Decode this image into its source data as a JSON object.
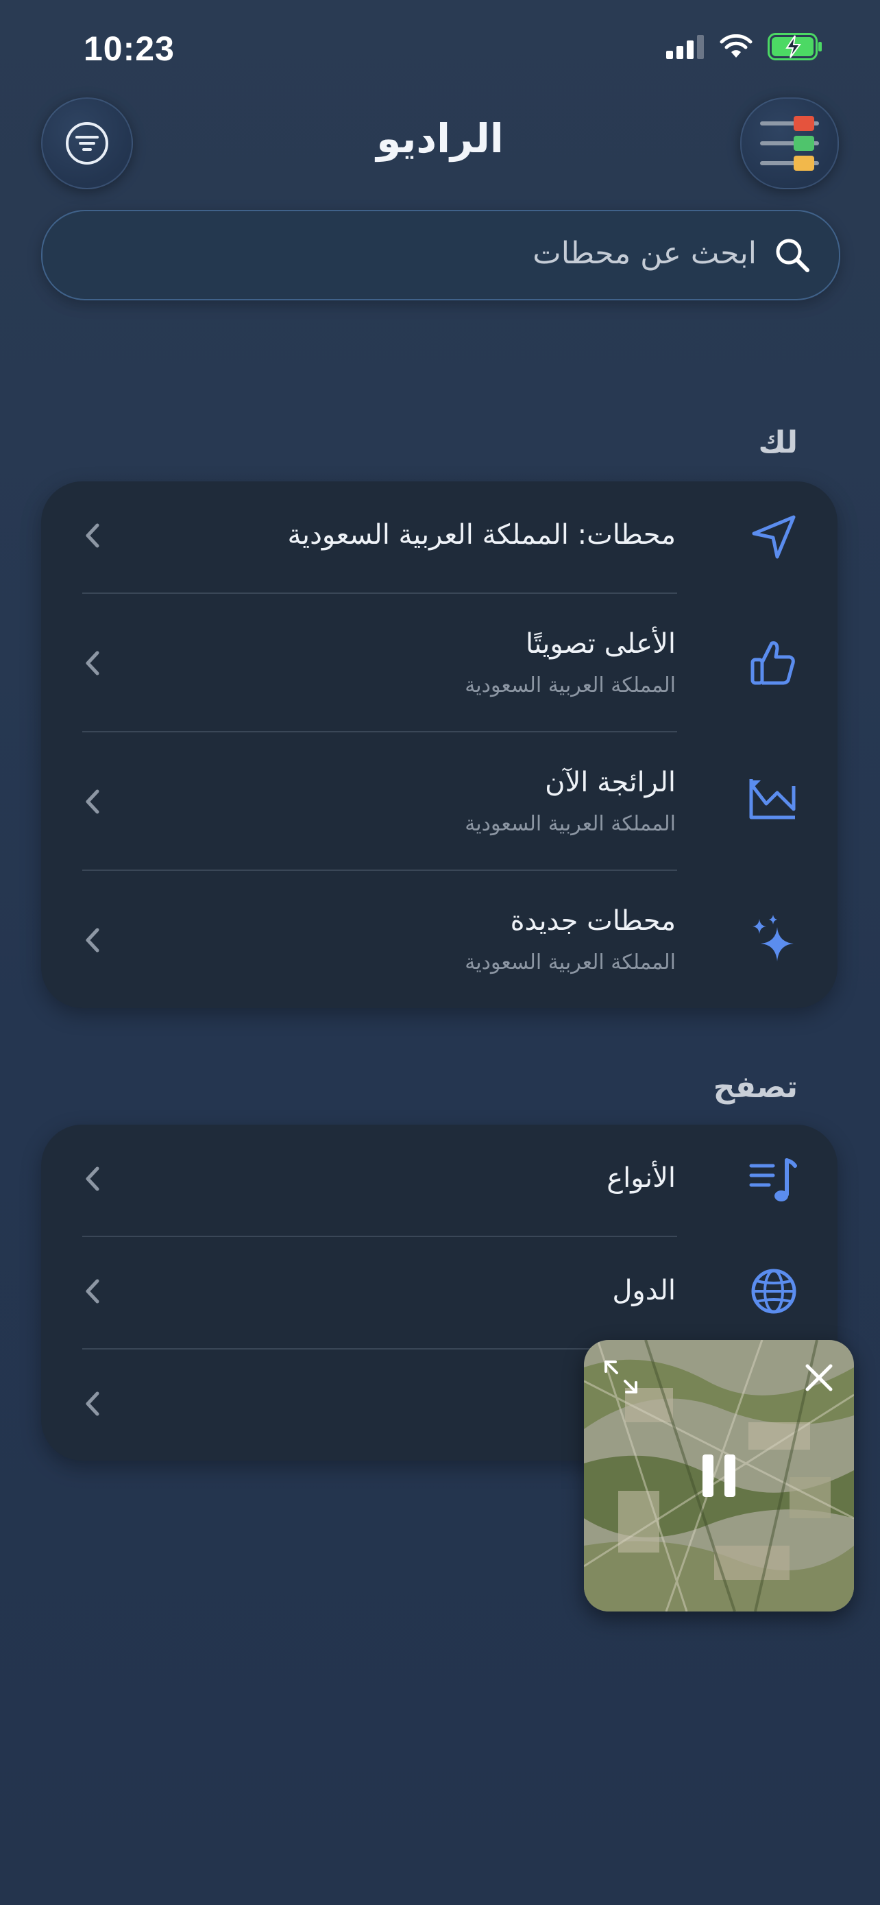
{
  "status_bar": {
    "time": "10:23"
  },
  "header": {
    "title": "الراديو"
  },
  "search": {
    "placeholder": "ابحث عن محطات"
  },
  "for_you": {
    "heading": "لك",
    "items": [
      {
        "title": "محطات: المملكة العربية السعودية",
        "icon": "location-arrow-icon"
      },
      {
        "title": "الأعلى تصويتًا",
        "subtitle": "المملكة العربية السعودية",
        "icon": "thumbs-up-icon"
      },
      {
        "title": "الرائجة الآن",
        "subtitle": "المملكة العربية السعودية",
        "icon": "trending-chart-icon"
      },
      {
        "title": "محطات جديدة",
        "subtitle": "المملكة العربية السعودية",
        "icon": "sparkles-icon"
      }
    ]
  },
  "browse": {
    "heading": "تصفح",
    "items": [
      {
        "title": "الأنواع",
        "icon": "music-list-icon"
      },
      {
        "title": "الدول",
        "icon": "globe-icon"
      },
      {
        "title": "",
        "icon": ""
      }
    ]
  },
  "colors": {
    "accent": "#5b8def",
    "background": "#2a3b53",
    "card": "#1f2b3a"
  }
}
